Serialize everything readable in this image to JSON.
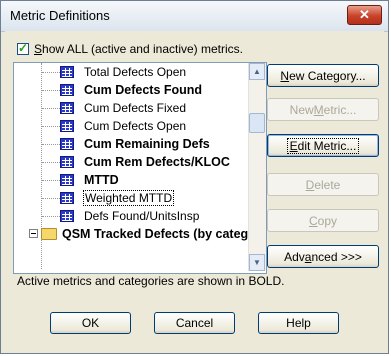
{
  "window": {
    "title": "Metric Definitions",
    "close_glyph": "✕"
  },
  "show_all": {
    "checked": true,
    "check_glyph": "✓",
    "label_pre": "",
    "label_mnemonic": "S",
    "label_post": "how ALL (active and inactive) metrics."
  },
  "tree": {
    "items": [
      {
        "label": "Total Defects Open",
        "bold": false
      },
      {
        "label": "Cum Defects Found",
        "bold": true
      },
      {
        "label": "Cum Defects Fixed",
        "bold": false
      },
      {
        "label": "Cum Defects Open",
        "bold": false
      },
      {
        "label": "Cum Remaining Defs",
        "bold": true
      },
      {
        "label": "Cum Rem Defects/KLOC",
        "bold": true
      },
      {
        "label": "MTTD",
        "bold": true
      },
      {
        "label": "Weighted MTTD",
        "bold": false,
        "selected": true
      },
      {
        "label": "Defs Found/UnitsInsp",
        "bold": false
      }
    ],
    "category": {
      "label": "QSM Tracked Defects (by catego"
    }
  },
  "buttons": {
    "new_category": {
      "pre": "",
      "mn": "N",
      "post": "ew Category..."
    },
    "new_metric": {
      "pre": "New ",
      "mn": "M",
      "post": "etric..."
    },
    "edit_metric": {
      "pre": "",
      "mn": "E",
      "post": "dit Metric..."
    },
    "delete": {
      "pre": "",
      "mn": "D",
      "post": "elete"
    },
    "copy": {
      "pre": "",
      "mn": "C",
      "post": "opy"
    },
    "advanced": {
      "pre": "Adv",
      "mn": "a",
      "post": "nced >>>"
    },
    "ok": "OK",
    "cancel": "Cancel",
    "help": "Help"
  },
  "status_text": "Active metrics and categories are shown in BOLD."
}
